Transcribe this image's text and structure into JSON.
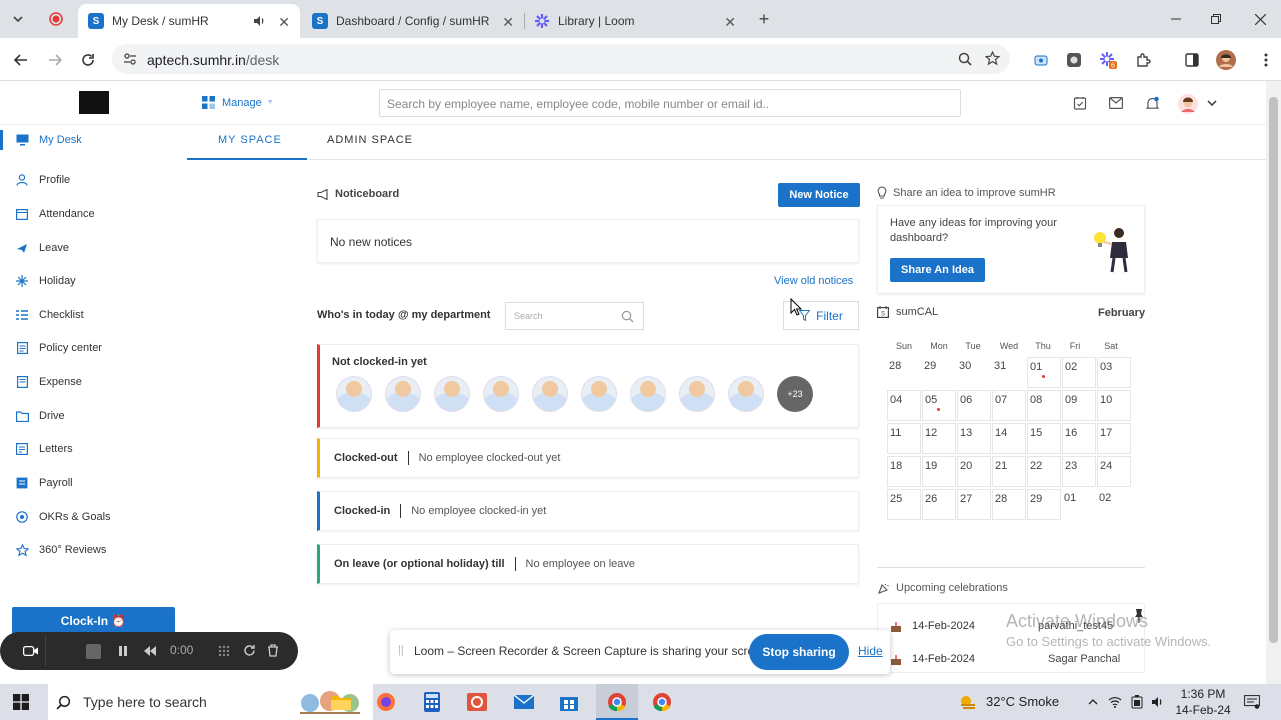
{
  "browser": {
    "tabs": [
      {
        "title": "My Desk / sumHR",
        "active": true
      },
      {
        "title": "Dashboard / Config / sumHR",
        "active": false
      },
      {
        "title": "Library | Loom",
        "active": false
      }
    ],
    "url_host": "aptech.sumhr.in",
    "url_path": "/desk"
  },
  "header": {
    "manage_label": "Manage",
    "search_placeholder": "Search by employee name, employee code, mobile number or email id.."
  },
  "sidebar": {
    "items": [
      {
        "label": "My Desk",
        "icon": "monitor-icon",
        "active": true
      },
      {
        "label": "Profile",
        "icon": "person-icon"
      },
      {
        "label": "Attendance",
        "icon": "calendar-icon"
      },
      {
        "label": "Leave",
        "icon": "plane-icon"
      },
      {
        "label": "Holiday",
        "icon": "sparkle-icon"
      },
      {
        "label": "Checklist",
        "icon": "checklist-icon"
      },
      {
        "label": "Policy center",
        "icon": "document-icon"
      },
      {
        "label": "Expense",
        "icon": "receipt-icon"
      },
      {
        "label": "Drive",
        "icon": "folder-icon"
      },
      {
        "label": "Letters",
        "icon": "letter-icon"
      },
      {
        "label": "Payroll",
        "icon": "payroll-icon"
      },
      {
        "label": "OKRs & Goals",
        "icon": "target-icon"
      },
      {
        "label": "360° Reviews",
        "icon": "star-icon"
      }
    ],
    "clockin_label": "Clock-In ⏰"
  },
  "spacetabs": {
    "my_space": "MY SPACE",
    "admin_space": "ADMIN SPACE"
  },
  "noticeboard": {
    "title": "Noticeboard",
    "new_notice": "New Notice",
    "empty": "No new notices",
    "view_old": "View old notices"
  },
  "whosin": {
    "title": "Who's in today @ my department",
    "search_placeholder": "Search",
    "filter_label": "Filter",
    "not_clocked_in": "Not clocked-in yet",
    "more_count": "+23",
    "rows": [
      {
        "title": "Clocked-out",
        "detail": "No employee clocked-out yet",
        "color": "#f0b400"
      },
      {
        "title": "Clocked-in",
        "detail": "No employee clocked-in yet",
        "color": "#1a73c8"
      },
      {
        "title": "On leave (or optional holiday) till",
        "detail": "No employee on leave",
        "color": "#2aa876"
      }
    ]
  },
  "idea": {
    "title": "Share an idea to improve sumHR",
    "body": "Have any ideas for improving your dashboard?",
    "button": "Share An Idea"
  },
  "calendar": {
    "title": "sumCAL",
    "month": "February",
    "weekdays": [
      "Sun",
      "Mon",
      "Tue",
      "Wed",
      "Thu",
      "Fri",
      "Sat"
    ],
    "days": [
      "28",
      "29",
      "30",
      "31",
      "01",
      "02",
      "03",
      "04",
      "05",
      "06",
      "07",
      "08",
      "09",
      "10",
      "11",
      "12",
      "13",
      "14",
      "15",
      "16",
      "17",
      "18",
      "19",
      "20",
      "21",
      "22",
      "23",
      "24",
      "25",
      "26",
      "27",
      "28",
      "29",
      "01",
      "02"
    ]
  },
  "celebrations": {
    "title": "Upcoming celebrations",
    "items": [
      {
        "date": "14-Feb-2024",
        "name": "parvathi_test45"
      },
      {
        "date": "14-Feb-2024",
        "name": "Sagar Panchal"
      }
    ]
  },
  "loom": {
    "time": "0:00",
    "sharing_text": "Loom – Screen Recorder & Screen Capture is sharing your screen.",
    "stop": "Stop sharing",
    "hide": "Hide"
  },
  "watermark": {
    "line1": "Activate Windows",
    "line2": "Go to Settings to activate Windows."
  },
  "taskbar": {
    "search_placeholder": "Type here to search",
    "weather": "32°C  Smoke",
    "time": "1:36 PM",
    "date": "14-Feb-24"
  },
  "colors": {
    "accent": "#1a73c8",
    "notclocked": "#e53935"
  }
}
